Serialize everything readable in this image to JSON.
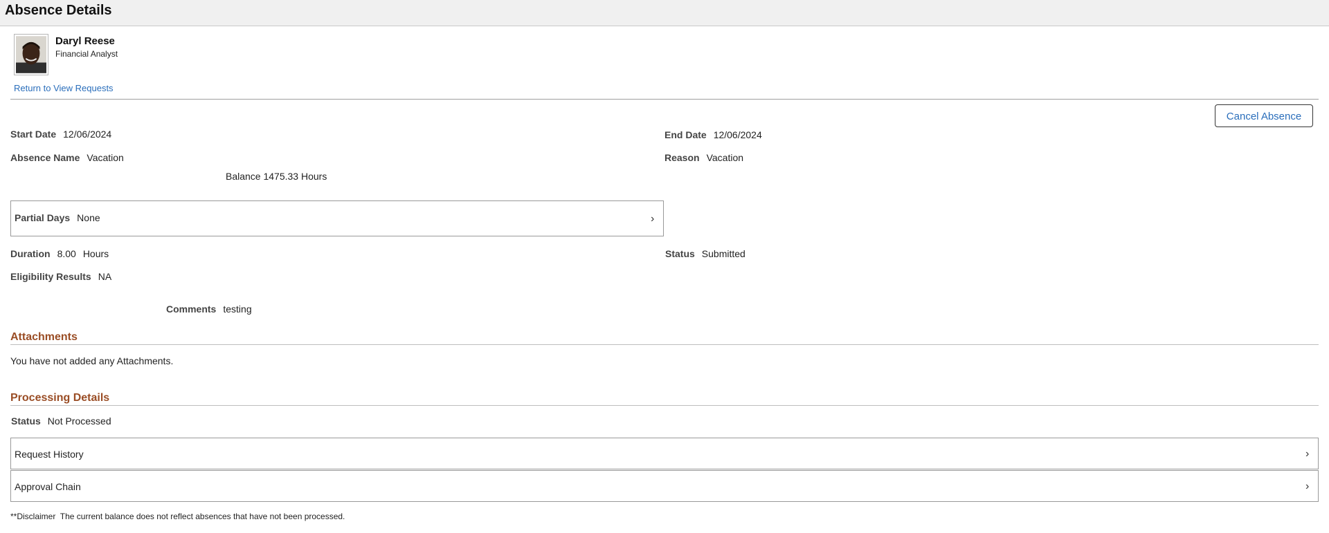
{
  "page": {
    "title": "Absence Details"
  },
  "employee": {
    "name": "Daryl Reese",
    "job_title": "Financial Analyst"
  },
  "links": {
    "return": "Return to View Requests"
  },
  "actions": {
    "cancel": "Cancel Absence"
  },
  "details": {
    "start_date_label": "Start Date",
    "start_date": "12/06/2024",
    "end_date_label": "End Date",
    "end_date": "12/06/2024",
    "absence_name_label": "Absence Name",
    "absence_name": "Vacation",
    "reason_label": "Reason",
    "reason": "Vacation",
    "balance_label": "Balance",
    "balance_value": "1475.33",
    "balance_unit": "Hours",
    "partial_days_label": "Partial Days",
    "partial_days": "None",
    "duration_label": "Duration",
    "duration_value": "8.00",
    "duration_unit": "Hours",
    "status_label": "Status",
    "status": "Submitted",
    "eligibility_label": "Eligibility Results",
    "eligibility": "NA",
    "comments_label": "Comments",
    "comments": "testing"
  },
  "attachments": {
    "heading": "Attachments",
    "empty_text": "You have not added any Attachments."
  },
  "processing": {
    "heading": "Processing Details",
    "status_label": "Status",
    "status": "Not Processed",
    "rows": [
      {
        "label": "Request History"
      },
      {
        "label": "Approval Chain"
      }
    ]
  },
  "disclaimer": {
    "prefix": "**Disclaimer",
    "text": "The current balance does not reflect absences that have not been processed."
  }
}
